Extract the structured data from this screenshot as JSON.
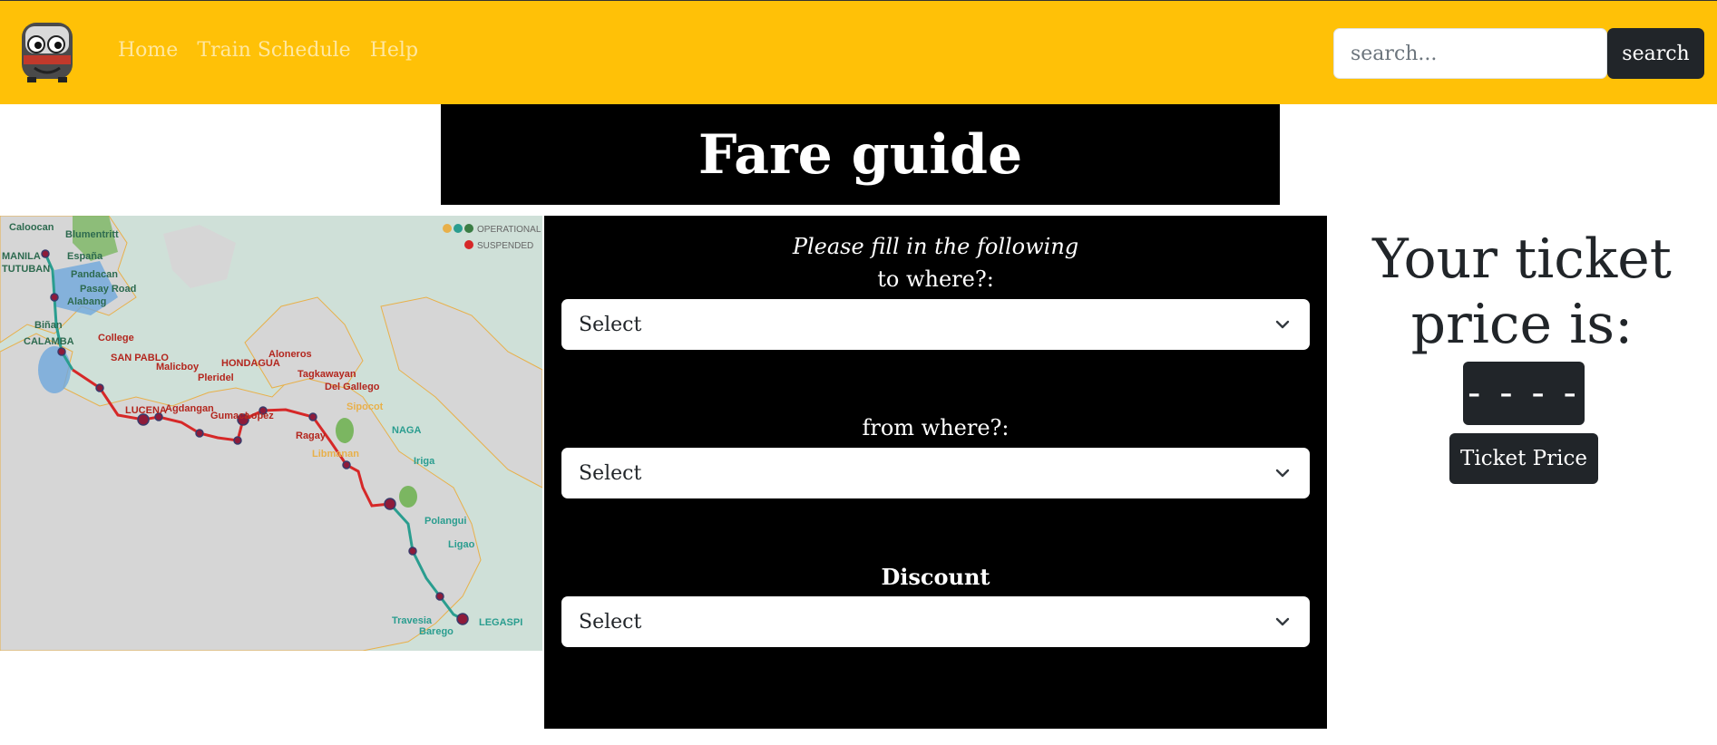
{
  "navbar": {
    "logo": "train-mascot-logo",
    "links": [
      "Home",
      "Train Schedule",
      "Help"
    ],
    "search_placeholder": "search...",
    "search_button": "search",
    "background": "#ffc107"
  },
  "title": "Fare guide",
  "map": {
    "legend": [
      "OPERATIONAL",
      "SUSPENDED"
    ],
    "stations": [
      "Caloocan",
      "Blumentritt",
      "MANILA",
      "España",
      "TUTUBAN",
      "Pandacan",
      "Pasay Road",
      "Alabang",
      "Biñan",
      "CALAMBA",
      "College",
      "SAN PABLO",
      "Malicboy",
      "HONDAGUA",
      "Aloneros",
      "Tagkawayan",
      "Pleridel",
      "Del Gallego",
      "LUCENA",
      "Agdangan",
      "Gumaca",
      "Lopez",
      "Sipocot",
      "Ragay",
      "NAGA",
      "Libmanan",
      "Iriga",
      "Polangui",
      "Ligao",
      "Travesia",
      "Barego",
      "LEGASPI"
    ],
    "colors": {
      "operational_line": "#2a9d8f",
      "suspended_line": "#d62828",
      "water": "#cfe0d8",
      "land": "#d9d9d9"
    }
  },
  "form": {
    "intro": "Please fill in the following",
    "to_label": "to where?:",
    "to_value": "Select",
    "from_label": "from where?:",
    "from_value": "Select",
    "discount_label": "Discount",
    "discount_value": "Select"
  },
  "ticket": {
    "heading": "Your ticket price is:",
    "price": "- - - -",
    "button": "Ticket Price"
  }
}
